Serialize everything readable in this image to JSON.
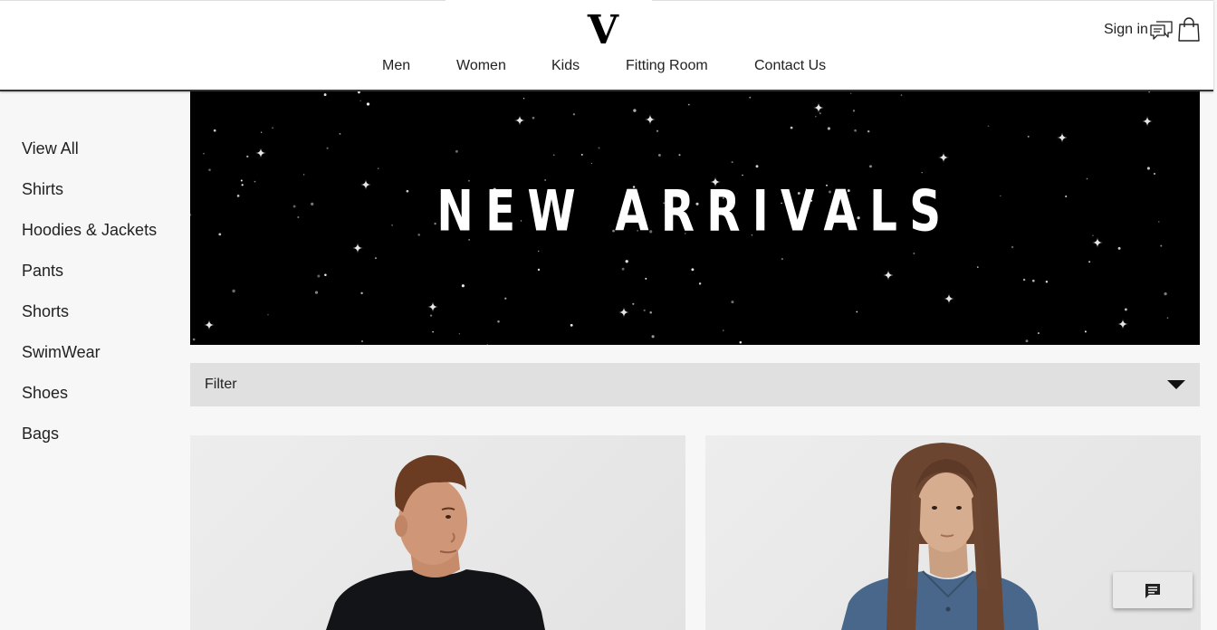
{
  "header": {
    "logo_text": "V",
    "nav": [
      "Men",
      "Women",
      "Kids",
      "Fitting Room",
      "Contact Us"
    ],
    "signin_label": "Sign in",
    "icons": [
      "chat-bubbles-icon",
      "shopping-bag-icon"
    ]
  },
  "sidebar": {
    "items": [
      "View All",
      "Shirts",
      "Hoodies & Jackets",
      "Pants",
      "Shorts",
      "SwimWear",
      "Shoes",
      "Bags"
    ]
  },
  "banner": {
    "title": "NEW ARRIVALS",
    "background": "#000000",
    "decoration": "stars"
  },
  "filter": {
    "label": "Filter",
    "icon": "caret-down-icon"
  },
  "products": [
    {
      "image": "product-photo-man-black-tshirt"
    },
    {
      "image": "product-photo-man-blue-shirt-long-hair"
    }
  ],
  "chat_widget": {
    "icon": "message-icon"
  },
  "colors": {
    "accent": "#000000",
    "filter_bg": "#e0e0e0",
    "page_bg": "#f7f7f7"
  }
}
